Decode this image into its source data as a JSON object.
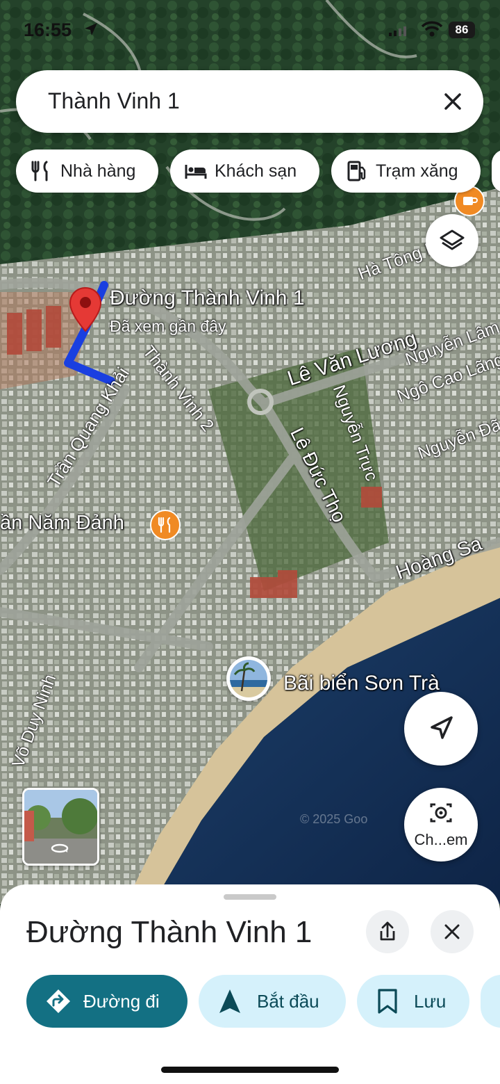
{
  "status_bar": {
    "time": "16:55",
    "battery": "86"
  },
  "search": {
    "query": "Thành Vinh 1"
  },
  "chips": [
    {
      "label": "Nhà hàng",
      "icon": "restaurant-icon"
    },
    {
      "label": "Khách sạn",
      "icon": "hotel-icon"
    },
    {
      "label": "Trạm xăng",
      "icon": "gas-station-icon"
    }
  ],
  "map": {
    "pin_title": "Đường Thành Vinh 1",
    "pin_subtitle": "Đã xem gần đây",
    "streets": {
      "ha_tong": "Hà Tông H",
      "le_van_luong": "Lê Văn Lương",
      "nguyen_lam": "Nguyễn Lâm",
      "ngo_cao_lang": "Ngô Cao Lãng",
      "nguyen_truc": "Nguyễn Trực",
      "nguyen_da": "Nguyễn Đã",
      "thanh_vinh_2": "Thành Vinh 2",
      "tran_quang_khai": "Trần Quang Khải",
      "le_duc_tho": "Lê Đức Thọ",
      "hoang_sa": "Hoàng Sa",
      "vo_duy_ninh": "Võ Duy Ninh"
    },
    "poi_restaurant": "ần Năm Đảnh",
    "poi_beach": "Bãi biển Sơn Trà",
    "watermark": "© 2025 Goo",
    "lens_label": "Ch...em"
  },
  "sheet": {
    "title": "Đường Thành Vinh 1",
    "actions": [
      {
        "label": "Đường đi",
        "icon": "directions-icon"
      },
      {
        "label": "Bắt đầu",
        "icon": "navigate-icon"
      },
      {
        "label": "Lưu",
        "icon": "bookmark-icon"
      }
    ]
  },
  "colors": {
    "primary": "#137083",
    "action_bg": "#d5f1fb",
    "pin": "#e53935",
    "route": "#1a3fe0",
    "poi_orange": "#f08a24"
  }
}
